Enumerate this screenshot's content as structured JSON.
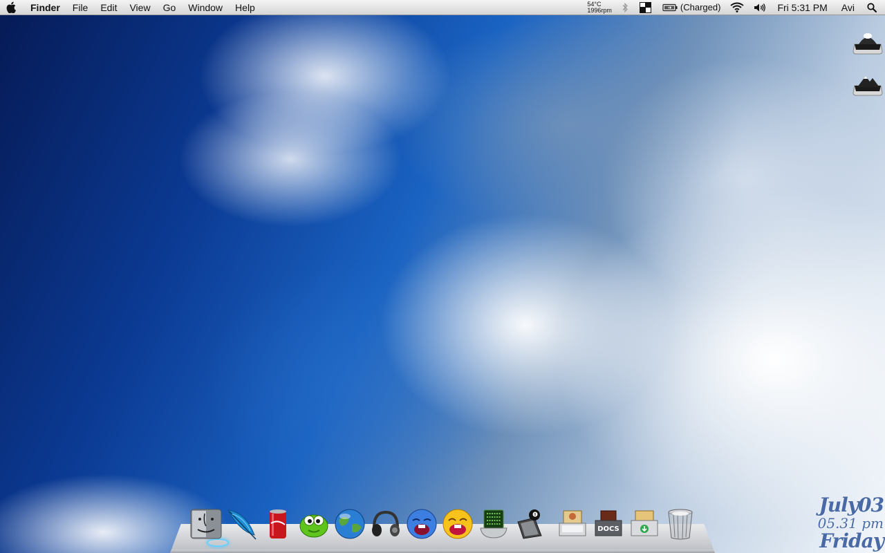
{
  "menubar": {
    "app_name": "Finder",
    "menus": [
      "File",
      "Edit",
      "View",
      "Go",
      "Window",
      "Help"
    ],
    "temp_line1": "54°C",
    "temp_line2": "1996rpm",
    "battery_status": "(Charged)",
    "clock": "Fri 5:31 PM",
    "user": "Avi",
    "icons": [
      "apple-icon",
      "bluetooth-icon",
      "spaces-icon",
      "battery-icon",
      "wifi-icon",
      "volume-icon",
      "spotlight-icon"
    ]
  },
  "desktop": {
    "drives": [
      "drive-icon",
      "drive-icon"
    ]
  },
  "clock_widget": {
    "date": "July03",
    "time": "05.31 pm",
    "day": "Friday"
  },
  "dock": {
    "items": [
      {
        "icon": "finder-icon",
        "running": true
      },
      {
        "icon": "quill-icon"
      },
      {
        "icon": "soda-can-icon"
      },
      {
        "icon": "green-monster-icon"
      },
      {
        "icon": "globe-icon"
      },
      {
        "icon": "headphones-icon"
      },
      {
        "icon": "blue-face-icon"
      },
      {
        "icon": "yellow-face-icon"
      },
      {
        "icon": "matrix-bowl-icon"
      },
      {
        "icon": "eight-ball-icon"
      },
      {
        "icon": "pictures-folder-icon"
      },
      {
        "icon": "docs-folder-icon",
        "label": "DOCS"
      },
      {
        "icon": "downloads-folder-icon"
      },
      {
        "icon": "trash-icon"
      }
    ]
  }
}
